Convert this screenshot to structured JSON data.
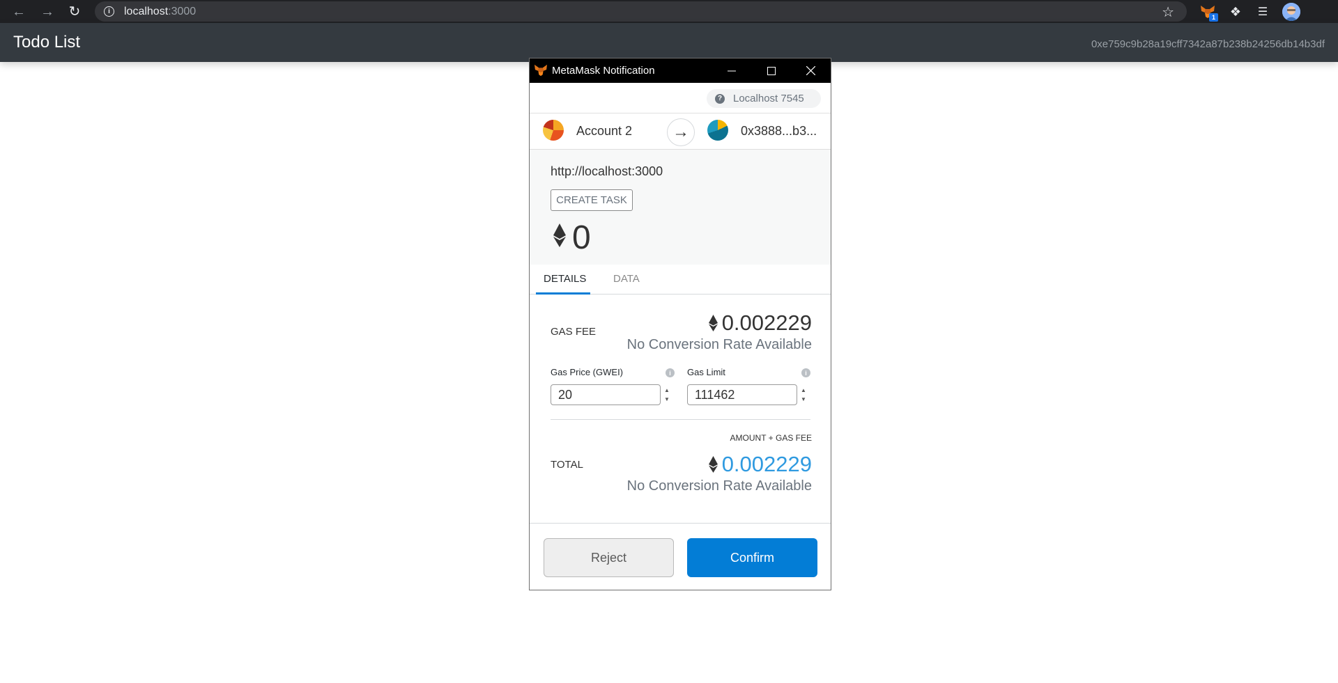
{
  "browser": {
    "url_host": "localhost",
    "url_port": ":3000",
    "extension_badge": "1"
  },
  "app": {
    "title": "Todo List",
    "account": "0xe759c9b28a19cff7342a87b238b24256db14b3df"
  },
  "metamask": {
    "window_title": "MetaMask Notification",
    "network": "Localhost 7545",
    "from_account": "Account 2",
    "to_address": "0x3888...b3...",
    "origin": "http://localhost:3000",
    "method": "CREATE TASK",
    "amount": "0",
    "tabs": {
      "details": "DETAILS",
      "data": "DATA"
    },
    "gas_fee_label": "GAS FEE",
    "gas_fee_amount": "0.002229",
    "gas_fee_conversion": "No Conversion Rate Available",
    "gas_price_label": "Gas Price (GWEI)",
    "gas_price_value": "20",
    "gas_limit_label": "Gas Limit",
    "gas_limit_value": "111462",
    "total_subtitle": "AMOUNT + GAS FEE",
    "total_label": "TOTAL",
    "total_amount": "0.002229",
    "total_conversion": "No Conversion Rate Available",
    "reject_label": "Reject",
    "confirm_label": "Confirm"
  },
  "colors": {
    "confirm_blue": "#037dd6",
    "total_blue": "#2f9ae0",
    "header_bg": "#343a40"
  }
}
